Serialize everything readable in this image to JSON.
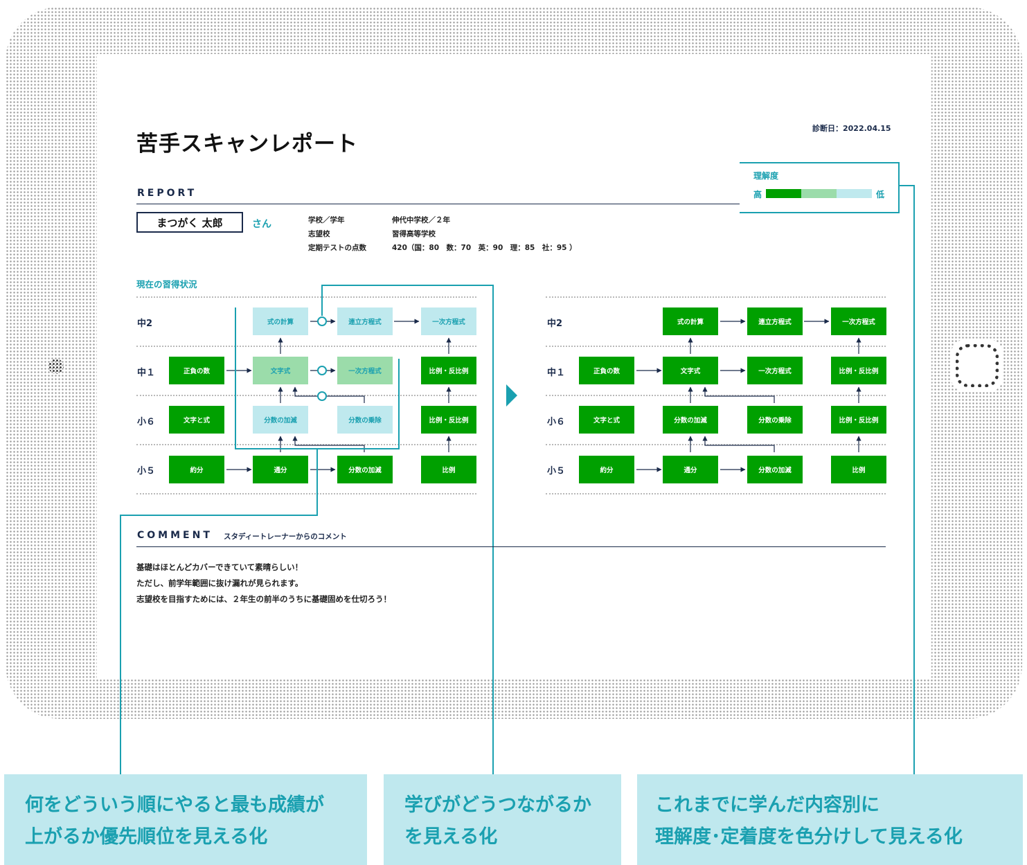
{
  "report": {
    "title": "苦手スキャンレポート",
    "date": "診断日：2022.04.15",
    "section_report": "REPORT",
    "student_name": "まつがく 太郎",
    "honorific": "さん",
    "info": [
      {
        "label": "学校／学年",
        "value": "伸代中学校／２年"
      },
      {
        "label": "志望校",
        "value": "習得高等学校"
      },
      {
        "label": "定期テストの点数",
        "value": "420（国：80　数：70　英：90　理：85　社：95 ）"
      }
    ],
    "legend": {
      "title": "理解度",
      "high": "高",
      "low": "低",
      "colors": [
        "#00a000",
        "#9bdcaa",
        "#bfe9ee"
      ]
    },
    "current_label": "現在の習得状況"
  },
  "grades": [
    "中2",
    "中１",
    "小６",
    "小５"
  ],
  "map_before": {
    "rows": [
      [
        "",
        "式の計算",
        "連立方程式",
        "一次方程式"
      ],
      [
        "正負の数",
        "文字式",
        "一次方程式",
        "比例・反比例"
      ],
      [
        "文字と式",
        "分数の加減",
        "分数の乗除",
        "比例・反比例"
      ],
      [
        "約分",
        "通分",
        "分数の加減",
        "比例"
      ]
    ],
    "levels": [
      [
        "",
        "low",
        "low",
        "low"
      ],
      [
        "high",
        "mid",
        "mid",
        "high"
      ],
      [
        "high",
        "low",
        "low",
        "high"
      ],
      [
        "high",
        "high",
        "high",
        "high"
      ]
    ]
  },
  "map_after": {
    "rows": [
      [
        "",
        "式の計算",
        "連立方程式",
        "一次方程式"
      ],
      [
        "正負の数",
        "文字式",
        "一次方程式",
        "比例・反比例"
      ],
      [
        "文字と式",
        "分数の加減",
        "分数の乗除",
        "比例・反比例"
      ],
      [
        "約分",
        "通分",
        "分数の加減",
        "比例"
      ]
    ]
  },
  "comment": {
    "heading": "COMMENT",
    "subheading": "スタディートレーナーからのコメント",
    "lines": [
      "基礎はほとんどカバーできていて素晴らしい！",
      "ただし、前学年範囲に抜け漏れが見られます。",
      "志望校を目指すためには、２年生の前半のうちに基礎固めを仕切ろう！"
    ]
  },
  "callouts": [
    {
      "line1": "何をどういう順にやると最も成績が",
      "line2": "上がるか優先順位を見える化"
    },
    {
      "line1": "学びがどうつながるか",
      "line2": "を見える化"
    },
    {
      "line1": "これまでに学んだ内容別に",
      "line2": "理解度･定着度を色分けして見える化"
    }
  ]
}
